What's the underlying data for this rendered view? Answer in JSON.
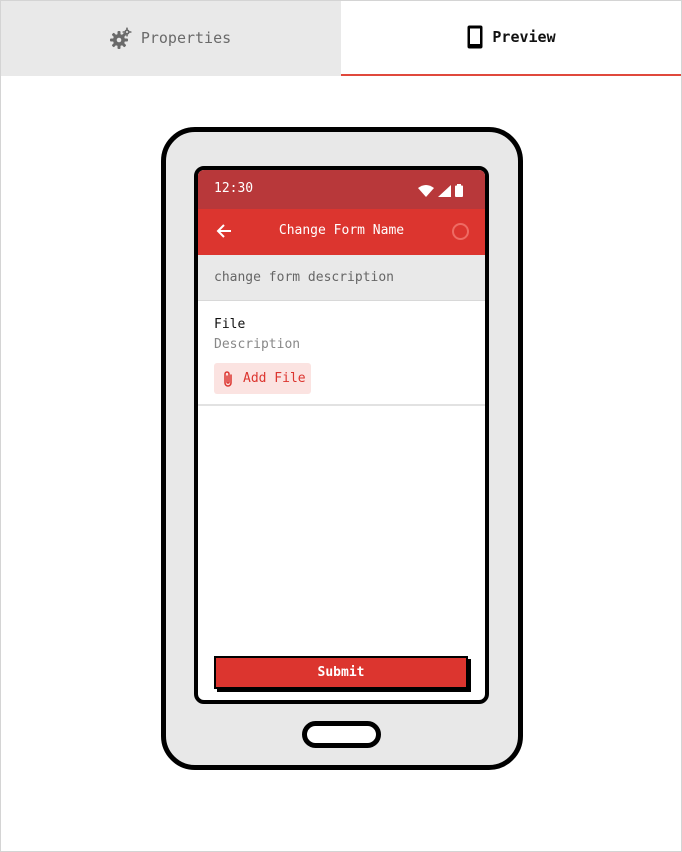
{
  "tabs": [
    {
      "label": "Properties",
      "icon": "gears-icon",
      "active": false
    },
    {
      "label": "Preview",
      "icon": "smartphone-icon",
      "active": true
    }
  ],
  "colors": {
    "accent": "#dc352f",
    "status_bar": "#b8383a",
    "tab_underline": "#e0483c",
    "add_file_bg": "#fbe3e1"
  },
  "phone": {
    "status_bar": {
      "time": "12:30",
      "icons": [
        "wifi-icon",
        "signal-icon",
        "battery-icon"
      ]
    },
    "app_bar": {
      "back_icon": "arrow-left-icon",
      "title": "Change Form Name",
      "status_icon": "circle-outline-icon"
    },
    "form_description": "change form description",
    "field": {
      "label": "File",
      "description": "Description",
      "add_button": {
        "label": "Add File",
        "icon": "paperclip-icon"
      }
    },
    "submit_label": "Submit"
  }
}
